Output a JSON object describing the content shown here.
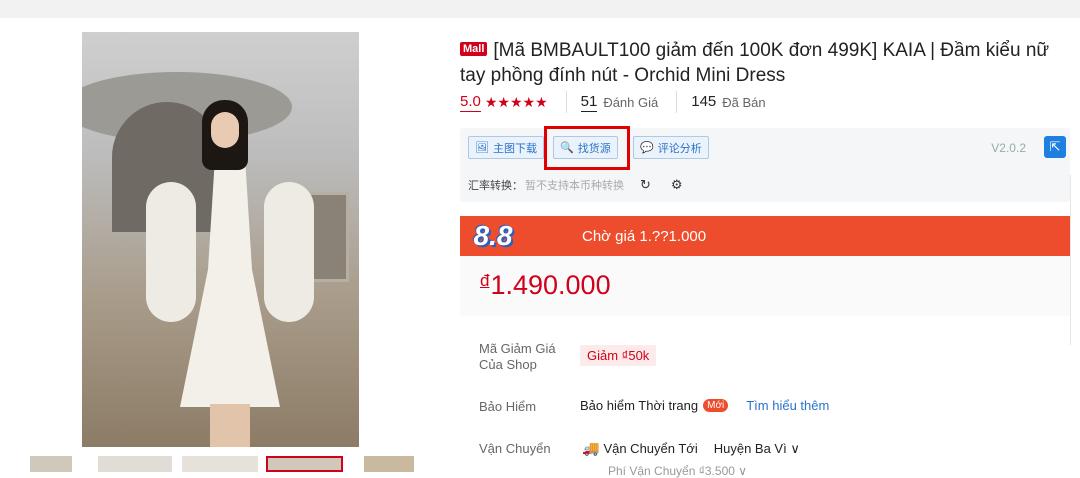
{
  "product": {
    "mall_badge": "Mall",
    "title": "[Mã BMBAULT100 giảm đến 100K đơn 499K] KAIA | Đầm kiểu nữ tay phồng đính nút - Orchid Mini Dress",
    "rating": "5.0",
    "stars": "★★★★★",
    "reviews_count": "51",
    "reviews_label": "Đánh Giá",
    "sold_count": "145",
    "sold_label": "Đã Bán"
  },
  "toolbox": {
    "btn_download": "主图下载",
    "btn_find_source": "找货源",
    "btn_review": "评论分析",
    "version": "V2.0.2",
    "rate_label": "汇率转换：",
    "rate_note": "暂不支持本币种转换"
  },
  "flash": {
    "badge": "8.8",
    "waiting_text": "Chờ giá 1.??1.000"
  },
  "price": {
    "currency": "đ",
    "value": "1.490.000"
  },
  "voucher": {
    "label": "Mã Giảm Giá Của Shop",
    "value": "Giảm ₫50k"
  },
  "insurance": {
    "label": "Bảo Hiểm",
    "text": "Bảo hiểm Thời trang",
    "badge": "Mới",
    "link": "Tìm hiểu thêm"
  },
  "shipping": {
    "label": "Vận Chuyển",
    "to": "Vận Chuyển Tới",
    "destination": "Huyện Ba Vì ∨",
    "fee_partial": "Phí Vận Chuyển   ₫3.500 ∨"
  },
  "colors": {
    "brand": "#ee4d2d",
    "price": "#d0011b",
    "link": "#2a73c9"
  }
}
